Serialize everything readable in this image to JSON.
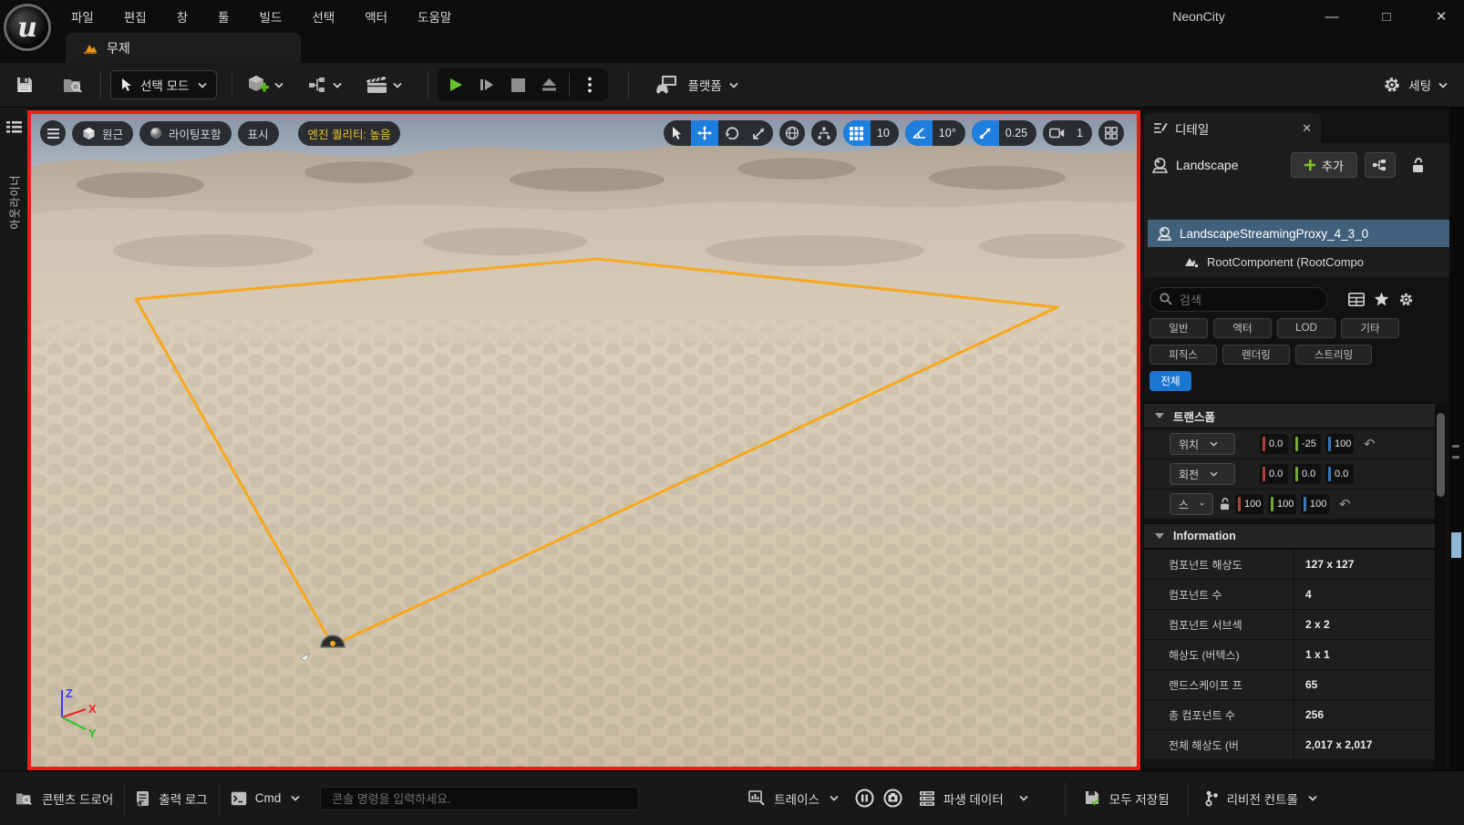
{
  "window": {
    "title": "NeonCity"
  },
  "menubar": {
    "items": [
      "파일",
      "편집",
      "창",
      "툴",
      "빌드",
      "선택",
      "액터",
      "도움말"
    ]
  },
  "tab": {
    "label": "무제"
  },
  "toolbar": {
    "select_mode": "선택 모드",
    "platform": "플랫폼",
    "settings": "세팅"
  },
  "outliner": {
    "label": "아웃라이너"
  },
  "viewport": {
    "perspective": "원근",
    "view_mode": "라이팅포함",
    "show": "표시",
    "engine_quality": "엔진 퀄리티: 높음",
    "grid_snap": "10",
    "angle_snap": "10°",
    "scale_snap": "0.25",
    "camera_speed": "1",
    "axis": {
      "x": "X",
      "y": "Y",
      "z": "Z"
    }
  },
  "details": {
    "tab_label": "디테일",
    "actor_name": "Landscape",
    "add_button": "추가",
    "selected_component": "LandscapeStreamingProxy_4_3_0",
    "root_component": "RootComponent (RootCompo",
    "search_placeholder": "검색",
    "filters_row1": [
      "일반",
      "액터",
      "LOD",
      "기타"
    ],
    "filters_row2": [
      "피직스",
      "렌더링",
      "스트리밍"
    ],
    "filter_all": "전체",
    "transform": {
      "title": "트랜스폼",
      "location_label": "위치",
      "rotation_label": "회전",
      "scale_label": "스",
      "location": [
        "0.0",
        "-25",
        "100"
      ],
      "rotation": [
        "0.0",
        "0.0",
        "0.0"
      ],
      "scale": [
        "100",
        "100",
        "100"
      ]
    },
    "information": {
      "title": "Information",
      "rows": [
        {
          "label": "컴포넌트 해상도",
          "value": "127 x 127"
        },
        {
          "label": "컴포넌트 수",
          "value": "4"
        },
        {
          "label": "컴포넌트 서브섹",
          "value": "2 x 2"
        },
        {
          "label": "해상도 (버텍스)",
          "value": "1 x 1"
        },
        {
          "label": "랜드스케이프 프",
          "value": "65"
        },
        {
          "label": "총 컴포넌트 수",
          "value": "256"
        },
        {
          "label": "전체 해상도 (버",
          "value": "2,017 x 2,017"
        }
      ]
    }
  },
  "statusbar": {
    "content_drawer": "콘텐츠 드로어",
    "output_log": "출력 로그",
    "cmd": "Cmd",
    "console_placeholder": "콘솔 명령을 입력하세요.",
    "trace": "트레이스",
    "derived_data": "파생 데이터",
    "save_status": "모두 저장됨",
    "revision_control": "리비전 컨트롤"
  },
  "colors": {
    "accent_blue": "#1f7fdf",
    "selection_blue": "#41607c",
    "record_border_red": "#e32119",
    "quad_orange": "#f7a81d",
    "quality_yellow": "#e9c427",
    "play_green": "#67c22d"
  }
}
